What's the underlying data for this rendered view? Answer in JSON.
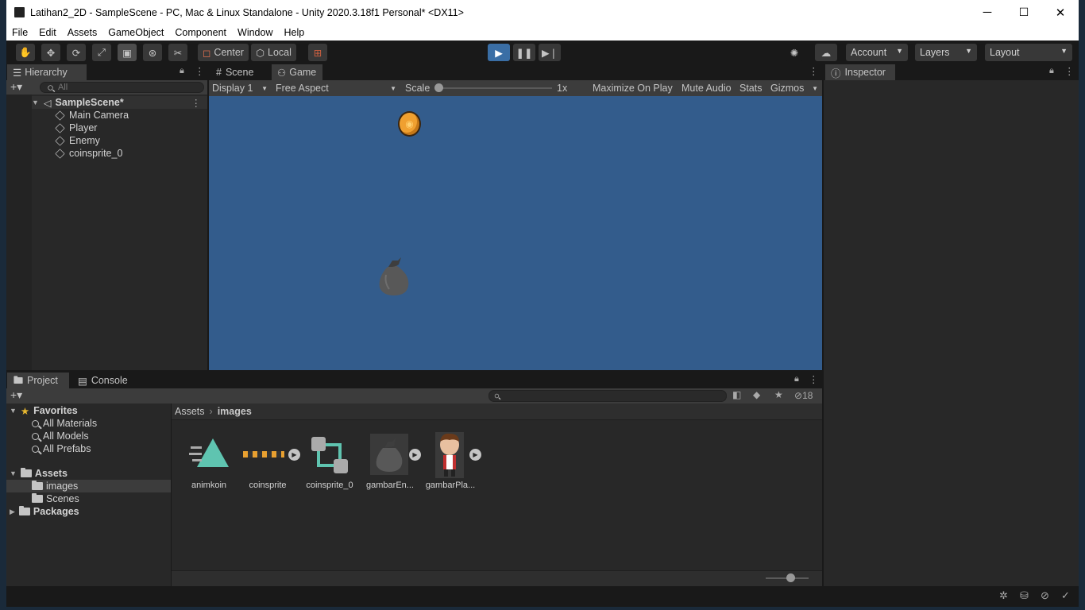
{
  "window": {
    "title": "Latihan2_2D - SampleScene - PC, Mac & Linux Standalone - Unity 2020.3.18f1 Personal* <DX11>",
    "minimize": "─",
    "maximize": "☐",
    "close": "✕"
  },
  "menu": [
    "File",
    "Edit",
    "Assets",
    "GameObject",
    "Component",
    "Window",
    "Help"
  ],
  "toolbar": {
    "center_label": "Center",
    "local_label": "Local",
    "account_label": "Account",
    "layers_label": "Layers",
    "layout_label": "Layout"
  },
  "hierarchy": {
    "tab": "Hierarchy",
    "search_placeholder": "All",
    "scene": "SampleScene*",
    "items": [
      "Main Camera",
      "Player",
      "Enemy",
      "coinsprite_0"
    ]
  },
  "game": {
    "scene_tab": "Scene",
    "game_tab": "Game",
    "display": "Display 1",
    "aspect": "Free Aspect",
    "scale_label": "Scale",
    "scale_value": "1x",
    "scale_level": 0.0,
    "maximize": "Maximize On Play",
    "mute": "Mute Audio",
    "stats": "Stats",
    "gizmos": "Gizmos",
    "bg_color": "#335c8c"
  },
  "inspector": {
    "tab": "Inspector"
  },
  "project": {
    "project_tab": "Project",
    "console_tab": "Console",
    "favorites": "Favorites",
    "fav_items": [
      "All Materials",
      "All Models",
      "All Prefabs"
    ],
    "assets": "Assets",
    "asset_folders": [
      "images",
      "Scenes"
    ],
    "packages": "Packages",
    "breadcrumb": [
      "Assets",
      "images"
    ],
    "hidden_count": "18",
    "files": [
      "animkoin",
      "coinsprite",
      "coinsprite_0",
      "gambarEn...",
      "gambarPla..."
    ]
  }
}
